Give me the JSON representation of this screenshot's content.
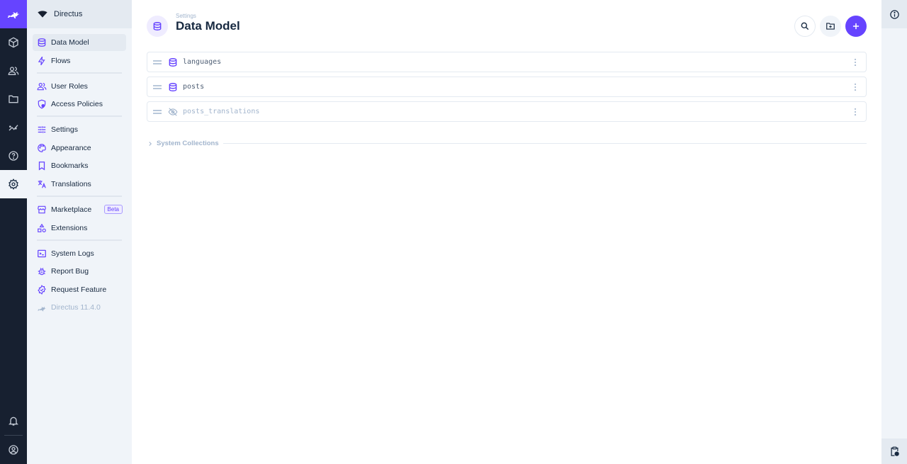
{
  "rail": {
    "logo": "directus-rabbit-logo",
    "items": [
      {
        "name": "content",
        "icon": "cube-icon",
        "active": false
      },
      {
        "name": "users",
        "icon": "users-icon",
        "active": false
      },
      {
        "name": "files",
        "icon": "folder-icon",
        "active": false
      },
      {
        "name": "insights",
        "icon": "insights-icon",
        "active": false
      },
      {
        "name": "help",
        "icon": "help-icon",
        "active": false
      },
      {
        "name": "settings",
        "icon": "gear-icon",
        "active": true
      }
    ],
    "bottom": [
      {
        "name": "notifications",
        "icon": "bell-icon"
      },
      {
        "name": "user-profile",
        "icon": "account-icon"
      }
    ]
  },
  "nav": {
    "project_name": "Directus",
    "groups": [
      [
        {
          "label": "Data Model",
          "icon": "database-icon",
          "active": true
        },
        {
          "label": "Flows",
          "icon": "bolt-icon"
        }
      ],
      [
        {
          "label": "User Roles",
          "icon": "group-icon"
        },
        {
          "label": "Access Policies",
          "icon": "policy-icon"
        }
      ],
      [
        {
          "label": "Settings",
          "icon": "tune-icon"
        },
        {
          "label": "Appearance",
          "icon": "palette-icon"
        },
        {
          "label": "Bookmarks",
          "icon": "bookmark-icon"
        },
        {
          "label": "Translations",
          "icon": "translate-icon"
        }
      ],
      [
        {
          "label": "Marketplace",
          "icon": "storefront-icon",
          "badge": "Beta"
        },
        {
          "label": "Extensions",
          "icon": "category-icon"
        }
      ],
      [
        {
          "label": "System Logs",
          "icon": "terminal-icon"
        },
        {
          "label": "Report Bug",
          "icon": "bug-icon"
        },
        {
          "label": "Request Feature",
          "icon": "verified-icon"
        },
        {
          "label": "Directus 11.4.0",
          "icon": "directus-icon",
          "muted": true
        }
      ]
    ]
  },
  "header": {
    "breadcrumb": "Settings",
    "title": "Data Model",
    "actions": {
      "search": "search-icon",
      "create_folder": "create-folder-icon",
      "create_collection": "add-icon"
    }
  },
  "collections": [
    {
      "name": "languages",
      "hidden": false
    },
    {
      "name": "posts",
      "hidden": false
    },
    {
      "name": "posts_translations",
      "hidden": true
    }
  ],
  "system_collections": {
    "label": "System Collections",
    "expanded": false
  },
  "sidebar": {
    "top_icon": "info-icon",
    "bottom_icon": "flow-clipboard-icon"
  },
  "colors": {
    "primary": "#6644ff",
    "rail_bg": "#172030",
    "nav_bg": "#f0f4f9",
    "muted": "#a2b5cd"
  }
}
